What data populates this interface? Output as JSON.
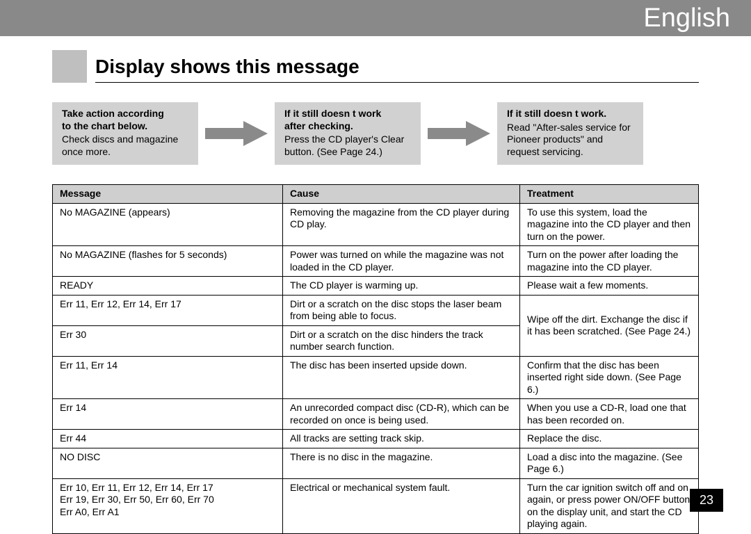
{
  "topbar": {
    "language": "English"
  },
  "heading": "Display shows this message",
  "steps": [
    {
      "title_line1": "Take action according",
      "title_line2": "to the chart below.",
      "body": "Check discs and magazine once more."
    },
    {
      "title_line1": "If it still doesn t work",
      "title_line2": "after checking.",
      "body": "Press the CD player's Clear button. (See Page 24.)"
    },
    {
      "title_line1": "If it still doesn t work.",
      "title_line2": "",
      "body": "Read \"After-sales service for Pioneer products\" and request servicing."
    }
  ],
  "table": {
    "headers": {
      "c1": "Message",
      "c2": "Cause",
      "c3": "Treatment"
    },
    "rows": [
      {
        "msg": "No MAGAZINE (appears)",
        "cause": "Removing the magazine from the CD player during CD play.",
        "treat": "To use this system, load the magazine into the CD player and then turn on the power."
      },
      {
        "msg": "No MAGAZINE (flashes for 5 seconds)",
        "cause": "Power was turned on while the magazine was not loaded in the CD player.",
        "treat": "Turn on the power after loading the magazine into the CD player."
      },
      {
        "msg": "READY",
        "cause": "The CD player is warming up.",
        "treat": "Please wait a few moments."
      },
      {
        "msg": "Err 11, Err 12, Err 14, Err 17",
        "cause": "Dirt or a scratch on the disc stops the laser beam from being able to focus.",
        "treat_span": true
      },
      {
        "msg": "Err 30",
        "cause": "Dirt or a scratch on the disc hinders the track number search function.",
        "treat": "Wipe off the dirt. Exchange the disc if it has been scratched. (See Page 24.)"
      },
      {
        "msg": "Err 11, Err 14",
        "cause": "The disc has been inserted upside down.",
        "treat": "Confirm that the disc has been inserted right side down. (See Page 6.)"
      },
      {
        "msg": "Err 14",
        "cause": "An unrecorded compact disc (CD-R), which can be recorded on once is being used.",
        "treat": "When you use a CD-R, load one that has been recorded on."
      },
      {
        "msg": "Err 44",
        "cause": "All tracks are setting track skip.",
        "treat": "Replace the disc."
      },
      {
        "msg": "NO DISC",
        "cause": "There is no disc in the magazine.",
        "treat": "Load a disc into the magazine. (See Page 6.)"
      },
      {
        "msg": "Err 10, Err 11, Err 12, Err 14, Err 17\nErr 19, Err 30, Err 50, Err 60, Err 70\nErr A0, Err A1",
        "cause": "Electrical or mechanical system fault.",
        "treat": "Turn the car ignition switch off and on again, or press power ON/OFF button on the display unit, and start the CD playing again."
      }
    ]
  },
  "page_number": "23"
}
